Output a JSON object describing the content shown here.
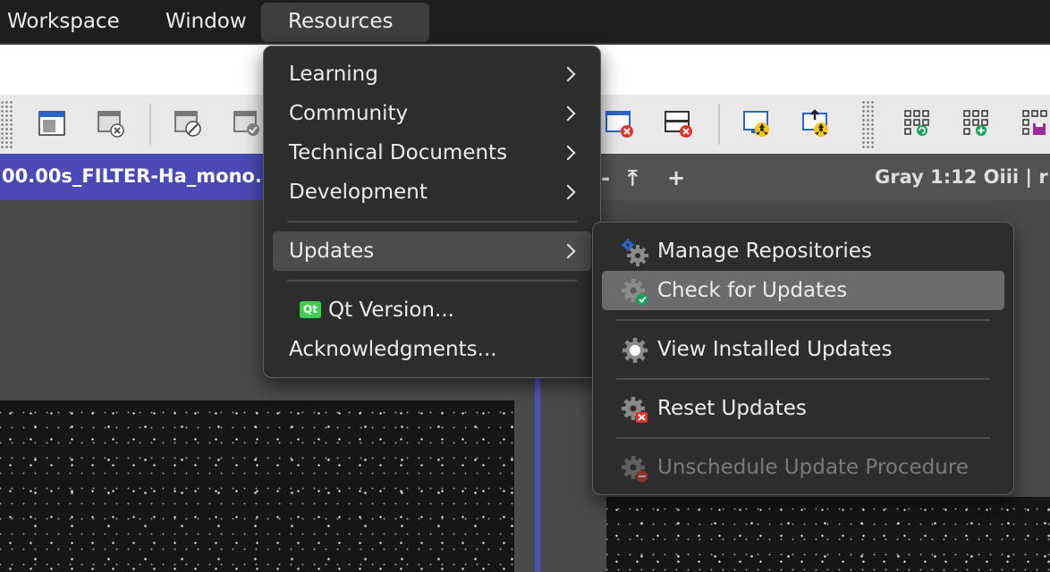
{
  "menubar": {
    "items": [
      {
        "label": "Workspace"
      },
      {
        "label": "Window"
      },
      {
        "label": "Resources"
      }
    ]
  },
  "toolbar": {
    "icons": [
      "new-window-icon",
      "close-window-icon",
      "mask-icon",
      "mask-check-icon",
      "close-red-icon",
      "close-red-icon",
      "radiation-icon",
      "radiation-upload-icon",
      "grid-refresh-icon",
      "grid-add-icon",
      "grid-save-icon"
    ]
  },
  "views": {
    "left_title": "00.00s_FILTER-Ha_mono.",
    "right_title": "Gray 1:12 Oiii | r",
    "right_controls": [
      "-",
      "⤒",
      "+"
    ]
  },
  "resources_menu": {
    "items": [
      {
        "label": "Learning",
        "submenu": true
      },
      {
        "label": "Community",
        "submenu": true
      },
      {
        "label": "Technical Documents",
        "submenu": true
      },
      {
        "label": "Development",
        "submenu": true
      },
      {
        "label": "Updates",
        "submenu": true,
        "highlighted": true
      },
      {
        "label": "Qt Version...",
        "icon": "Qt"
      },
      {
        "label": "Acknowledgments..."
      }
    ]
  },
  "updates_submenu": {
    "items": [
      {
        "label": "Manage Repositories",
        "icon": "gears-icon"
      },
      {
        "label": "Check for Updates",
        "icon": "gear-check-icon",
        "highlighted": true
      },
      {
        "label": "View Installed Updates",
        "icon": "gear-dot-icon"
      },
      {
        "label": "Reset Updates",
        "icon": "gear-x-icon"
      },
      {
        "label": "Unschedule Update Procedure",
        "icon": "gear-minus-icon",
        "disabled": true
      }
    ]
  },
  "colors": {
    "menubar_bg": "#1e1e1e",
    "menu_bg": "#2d2d2d",
    "left_title_bg": "#4a4ab6",
    "highlight": "#6b6b6b"
  }
}
